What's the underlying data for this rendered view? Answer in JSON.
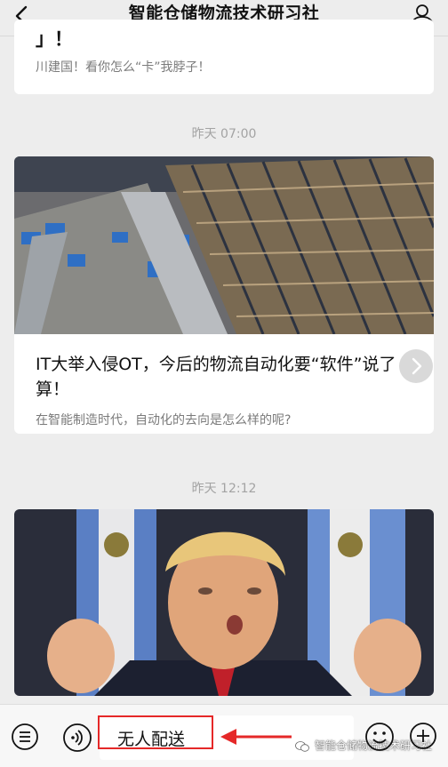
{
  "header": {
    "title": "智能仓储物流技术研习社",
    "back_icon": "chevron-left-icon",
    "profile_icon": "person-icon"
  },
  "feed": {
    "prev_card": {
      "title_fragment": "」！",
      "description": "川建国！看你怎么“卡”我脖子！"
    },
    "items": [
      {
        "timestamp": "昨天 07:00",
        "title": "IT大举入侵OT，今后的物流自动化要“软件”说了算！",
        "description": "在智能制造时代，自动化的去向是怎么样的呢?"
      },
      {
        "timestamp": "昨天 12:12"
      }
    ]
  },
  "input_bar": {
    "value": "无人配送",
    "menu_icon": "menu-list-icon",
    "voice_icon": "voice-icon",
    "emoji_icon": "emoji-icon",
    "plus_icon": "plus-icon"
  },
  "watermark": "智能仓储物流技术研习社",
  "colors": {
    "background": "#ededed",
    "annotation_red": "#e52828"
  }
}
